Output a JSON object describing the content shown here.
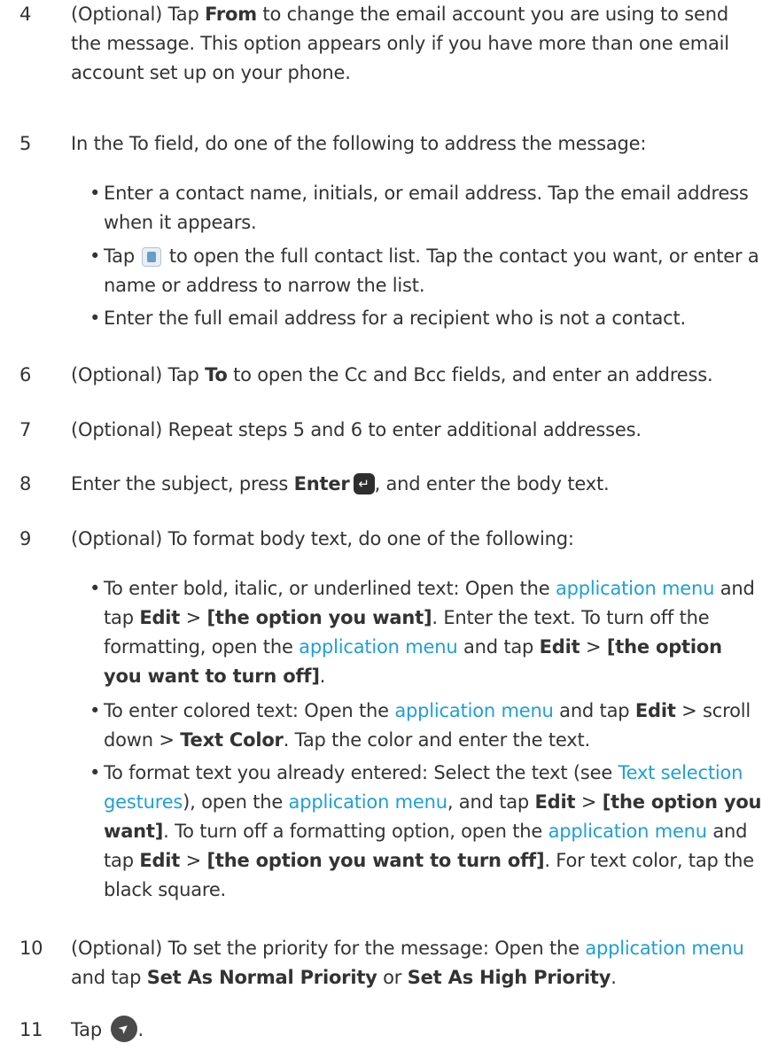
{
  "steps": {
    "s4": {
      "num": "4",
      "p1": "(Optional) Tap ",
      "b1": "From",
      "p2": " to change the email account you are using to send the message. This option appears only if you have more than one email account set up on your phone."
    },
    "s5": {
      "num": "5",
      "text": "In the To field, do one of the following to address the message:",
      "bullets": {
        "b1": "Enter a contact name, initials, or email address. Tap the email address when it appears.",
        "b2a": "Tap ",
        "b2b": " to open the full contact list. Tap the contact you want, or enter a name or address to narrow the list.",
        "b3": "Enter the full email address for a recipient who is not a contact."
      }
    },
    "s6": {
      "num": "6",
      "p1": "(Optional) Tap ",
      "b1": "To",
      "p2": " to open the Cc and Bcc fields, and enter an address."
    },
    "s7": {
      "num": "7",
      "text": "(Optional) Repeat steps 5 and 6 to enter additional addresses."
    },
    "s8": {
      "num": "8",
      "p1": "Enter the subject, press ",
      "b1": "Enter",
      "p2": ", and enter the body text."
    },
    "s9": {
      "num": "9",
      "text": "(Optional) To format body text, do one of the following:",
      "bullets": {
        "b1": {
          "p1": "To enter bold, italic, or underlined text: Open the ",
          "l1": "application menu",
          "p2": " and tap ",
          "e1": "Edit",
          "gt1": " > ",
          "o1": "[the option you want]",
          "p3": ". Enter the text. To turn off the formatting, open the ",
          "l2": "application menu",
          "p4": " and tap ",
          "e2": "Edit",
          "gt2": " > ",
          "o2": "[the option you want to turn off]",
          "p5": "."
        },
        "b2": {
          "p1": "To enter colored text: Open the ",
          "l1": "application menu",
          "p2": " and tap ",
          "e1": "Edit",
          "p3": " > scroll down > ",
          "tc": "Text Color",
          "p4": ". Tap the color and enter the text."
        },
        "b3": {
          "p1": "To format text you already entered: Select the text (see ",
          "l1": "Text selection gestures",
          "p2": "), open the ",
          "l2": "application menu",
          "p3": ", and tap ",
          "e1": "Edit",
          "gt1": " > ",
          "o1": "[the option you want]",
          "p4": ". To turn off a formatting option, open the ",
          "l3": "application menu",
          "p5": " and tap ",
          "e2": "Edit",
          "gt2": " > ",
          "o2": "[the option you want to turn off]",
          "p6": ". For text color, tap the black square."
        }
      }
    },
    "s10": {
      "num": "10",
      "p1": "(Optional) To set the priority for the message: Open the ",
      "l1": "application menu",
      "p2": " and tap ",
      "b1": "Set As Normal Priority",
      "p3": " or ",
      "b2": "Set As High Priority",
      "p4": "."
    },
    "s11": {
      "num": "11",
      "p1": "Tap ",
      "p2": "."
    }
  },
  "icons": {
    "contact": "contact-list-icon",
    "enter": "enter-key-icon",
    "send": "send-icon"
  },
  "colors": {
    "link": "#1e9fd7",
    "text": "#333333"
  }
}
